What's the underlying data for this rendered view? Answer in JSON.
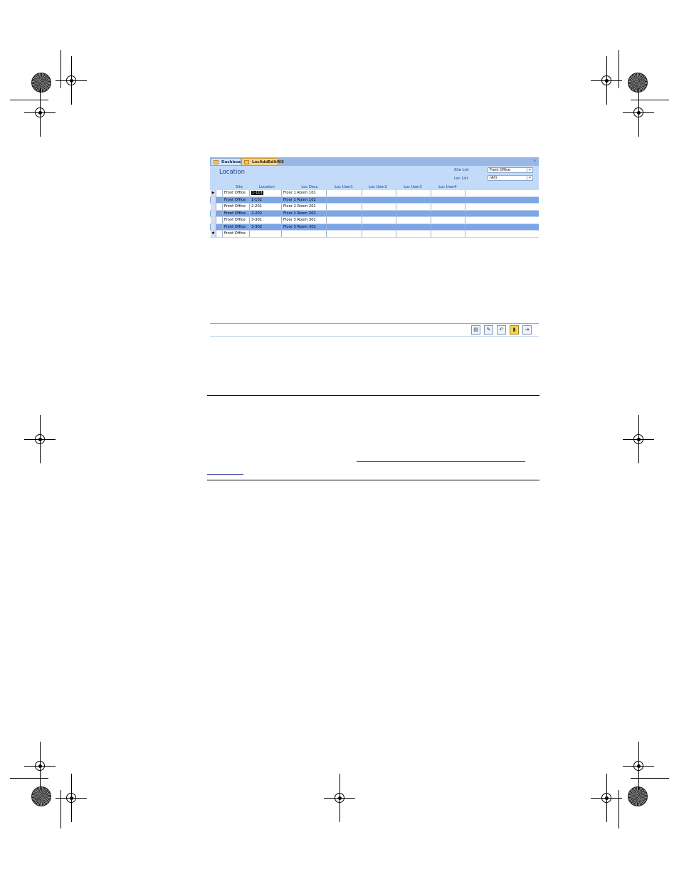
{
  "tabs": [
    {
      "label": "Dashboard",
      "active": false
    },
    {
      "label": "LocAddEditWS",
      "active": true
    }
  ],
  "close_glyph": "×",
  "form_title": "Location",
  "filters": {
    "site_list_label": "Site List",
    "site_list_value": "Front Office",
    "loc_list_label": "Loc List",
    "loc_list_value": "(All)"
  },
  "columns": [
    "Site",
    "Location",
    "Loc Desc",
    "Loc User1",
    "Loc User2",
    "Loc User3",
    "Loc User4"
  ],
  "rows": [
    {
      "site": "Front Office",
      "location": "1-101",
      "desc": "Floor 1 Room 101",
      "current": true
    },
    {
      "site": "Front Office",
      "location": "1-102",
      "desc": "Floor 1 Room 102"
    },
    {
      "site": "Front Office",
      "location": "2-201",
      "desc": "Floor 2 Room 201"
    },
    {
      "site": "Front Office",
      "location": "2-202",
      "desc": "Floor 2 Room 202"
    },
    {
      "site": "Front Office",
      "location": "3-301",
      "desc": "Floor 3 Room 301"
    },
    {
      "site": "Front Office",
      "location": "3-302",
      "desc": "Floor 3 Room 302"
    },
    {
      "site": "Front Office",
      "location": "",
      "desc": "",
      "new": true
    }
  ],
  "record_indicators": {
    "current": "▶",
    "new": "✱"
  },
  "toolbar_icons": [
    "new-record-icon",
    "save-record-icon",
    "undo-icon",
    "delete-icon",
    "close-form-icon"
  ],
  "colors": {
    "tab_bar": "#9ab6e2",
    "header": "#c3daf9",
    "alt_row": "#7ba6e8",
    "active_tab": "#f5d48d"
  }
}
